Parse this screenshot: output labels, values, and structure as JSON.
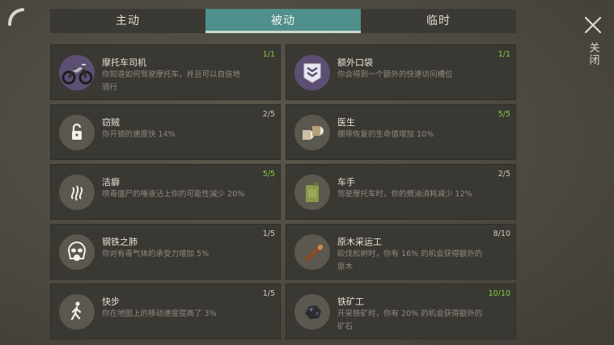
{
  "tabs": [
    {
      "label": "主动",
      "active": false
    },
    {
      "label": "被动",
      "active": true
    },
    {
      "label": "临时",
      "active": false
    }
  ],
  "close_label": "关闭",
  "colors": {
    "active_tab": "#4f8f8c",
    "max_level": "#7fd33f",
    "card": "#3a3832"
  },
  "perks": [
    {
      "name": "摩托车司机",
      "desc": "你知道如何驾驶摩托车，并且可以自信地骑行",
      "level": "1/1",
      "maxed": true,
      "icon": "motorcycle-icon"
    },
    {
      "name": "额外口袋",
      "desc": "你会得到一个额外的快速访问槽位",
      "level": "1/1",
      "maxed": true,
      "icon": "pocket-icon"
    },
    {
      "name": "窃贼",
      "desc": "你开锁的速度快 14%",
      "level": "2/5",
      "maxed": false,
      "icon": "lock-icon"
    },
    {
      "name": "医生",
      "desc": "绷带恢复的生命值增加 10%",
      "level": "5/5",
      "maxed": true,
      "icon": "bandage-icon"
    },
    {
      "name": "洁癖",
      "desc": "喷毒僵尸的唾液沾上你的可能性减少 20%",
      "level": "5/5",
      "maxed": true,
      "icon": "stench-icon"
    },
    {
      "name": "车手",
      "desc": "驾驶摩托车时，你的燃油消耗减少 12%",
      "level": "2/5",
      "maxed": false,
      "icon": "fuel-can-icon"
    },
    {
      "name": "钢铁之肺",
      "desc": "你对有毒气体的承受力增加 5%",
      "level": "1/5",
      "maxed": false,
      "icon": "gas-mask-icon"
    },
    {
      "name": "原木采运工",
      "desc": "砍伐松树时，你有 16% 的机会获得额外的原木",
      "level": "8/10",
      "maxed": false,
      "icon": "log-icon"
    },
    {
      "name": "快步",
      "desc": "你在地图上的移动速度提高了 3%",
      "level": "1/5",
      "maxed": false,
      "icon": "walking-icon"
    },
    {
      "name": "铁矿工",
      "desc": "开采铁矿时，你有 20% 的机会获得额外的矿石",
      "level": "10/10",
      "maxed": true,
      "icon": "iron-ore-icon"
    }
  ]
}
